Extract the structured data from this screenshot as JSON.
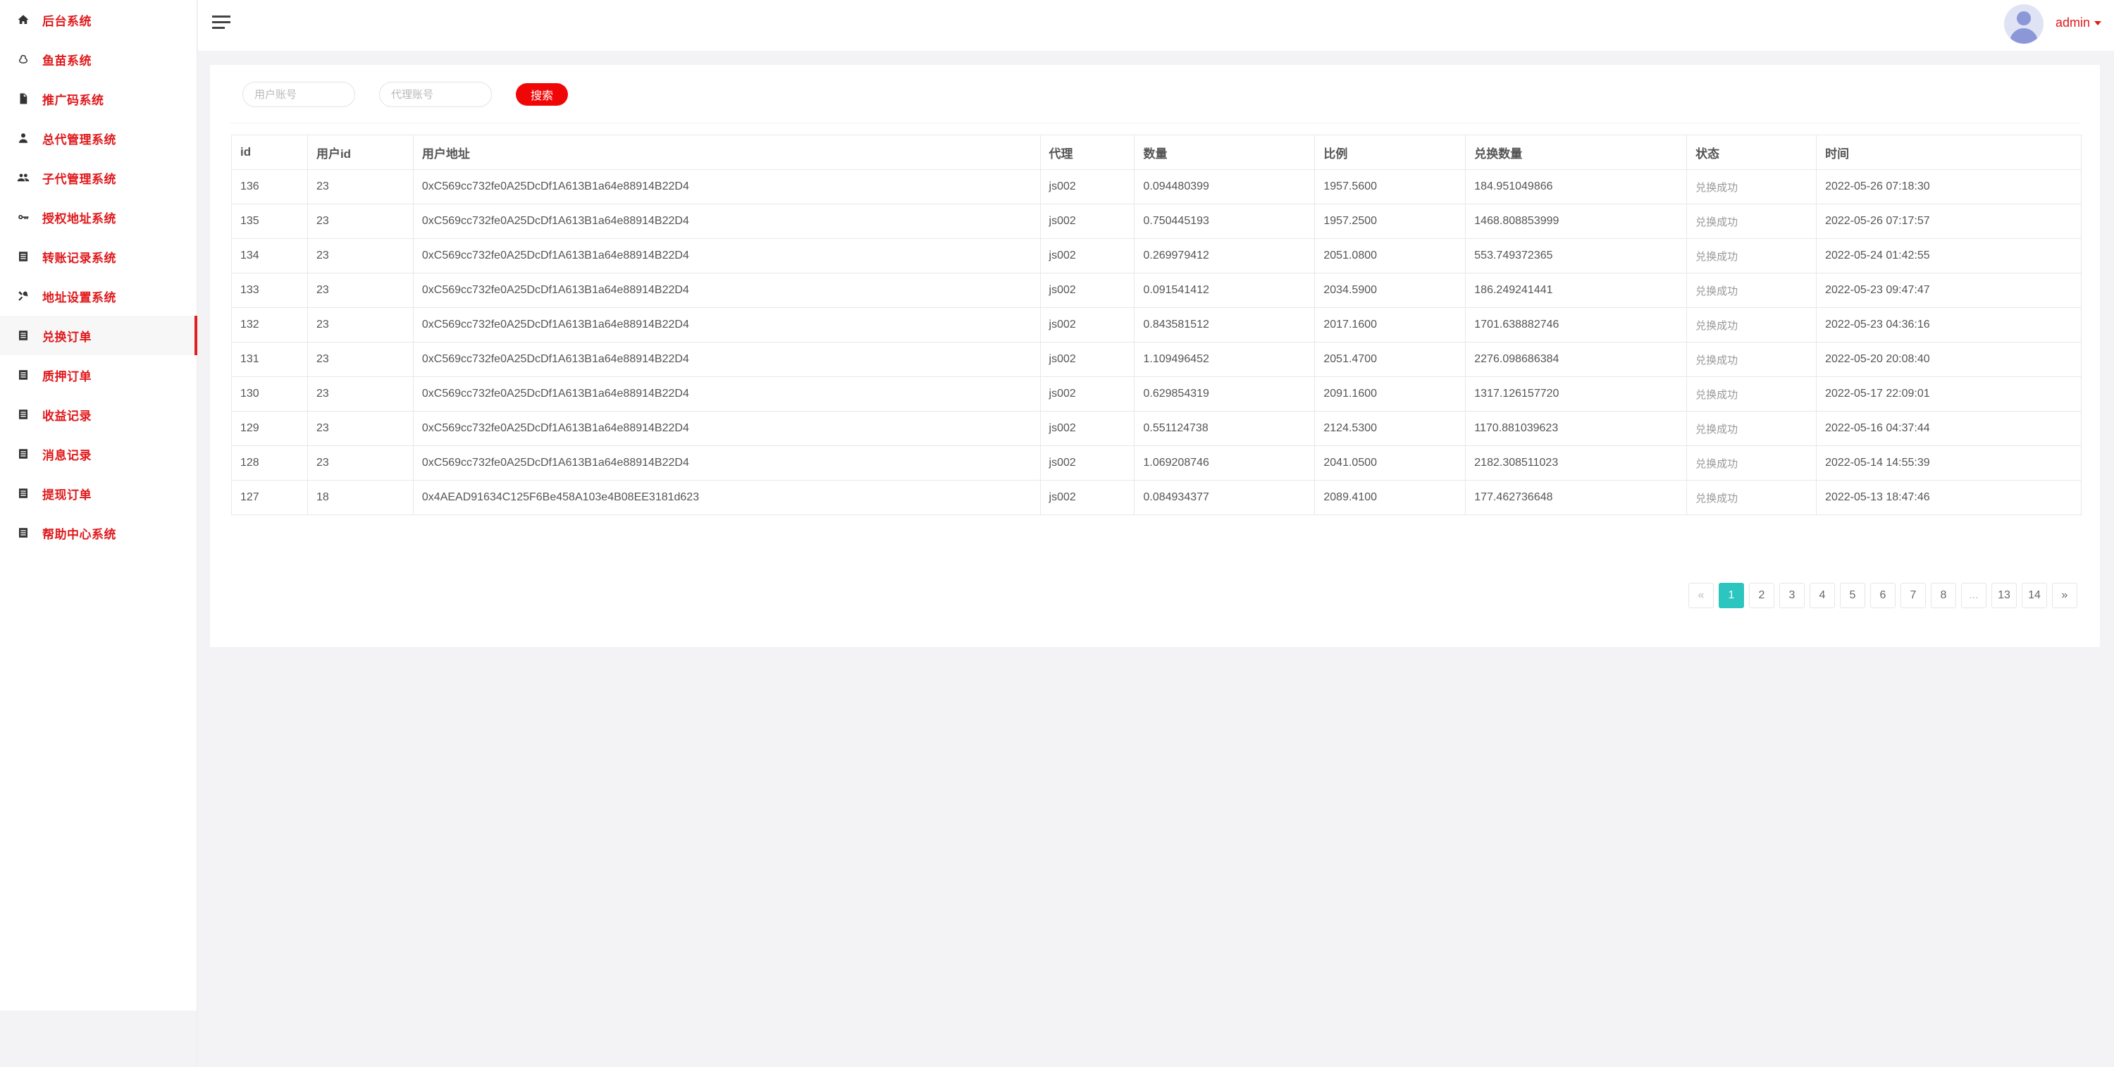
{
  "sidebar": {
    "items": [
      {
        "label": "后台系统",
        "icon": "home-icon"
      },
      {
        "label": "鱼苗系统",
        "icon": "fish-icon"
      },
      {
        "label": "推广码系统",
        "icon": "document-icon"
      },
      {
        "label": "总代管理系统",
        "icon": "person-icon"
      },
      {
        "label": "子代管理系统",
        "icon": "people-icon"
      },
      {
        "label": "授权地址系统",
        "icon": "key-icon"
      },
      {
        "label": "转账记录系统",
        "icon": "list-icon"
      },
      {
        "label": "地址设置系统",
        "icon": "tools-icon"
      },
      {
        "label": "兑换订单",
        "icon": "list-icon",
        "active": true
      },
      {
        "label": "质押订单",
        "icon": "list-icon"
      },
      {
        "label": "收益记录",
        "icon": "list-icon"
      },
      {
        "label": "消息记录",
        "icon": "list-icon"
      },
      {
        "label": "提现订单",
        "icon": "list-icon"
      },
      {
        "label": "帮助中心系统",
        "icon": "list-icon"
      }
    ]
  },
  "header": {
    "user_name": "admin"
  },
  "search": {
    "user_account_placeholder": "用户账号",
    "agent_account_placeholder": "代理账号",
    "search_label": "搜索"
  },
  "table": {
    "headers": [
      "id",
      "用户id",
      "用户地址",
      "代理",
      "数量",
      "比例",
      "兑换数量",
      "状态",
      "时间"
    ],
    "rows": [
      [
        "136",
        "23",
        "0xC569cc732fe0A25DcDf1A613B1a64e88914B22D4",
        "js002",
        "0.094480399",
        "1957.5600",
        "184.951049866",
        "兑换成功",
        "2022-05-26 07:18:30"
      ],
      [
        "135",
        "23",
        "0xC569cc732fe0A25DcDf1A613B1a64e88914B22D4",
        "js002",
        "0.750445193",
        "1957.2500",
        "1468.808853999",
        "兑换成功",
        "2022-05-26 07:17:57"
      ],
      [
        "134",
        "23",
        "0xC569cc732fe0A25DcDf1A613B1a64e88914B22D4",
        "js002",
        "0.269979412",
        "2051.0800",
        "553.749372365",
        "兑换成功",
        "2022-05-24 01:42:55"
      ],
      [
        "133",
        "23",
        "0xC569cc732fe0A25DcDf1A613B1a64e88914B22D4",
        "js002",
        "0.091541412",
        "2034.5900",
        "186.249241441",
        "兑换成功",
        "2022-05-23 09:47:47"
      ],
      [
        "132",
        "23",
        "0xC569cc732fe0A25DcDf1A613B1a64e88914B22D4",
        "js002",
        "0.843581512",
        "2017.1600",
        "1701.638882746",
        "兑换成功",
        "2022-05-23 04:36:16"
      ],
      [
        "131",
        "23",
        "0xC569cc732fe0A25DcDf1A613B1a64e88914B22D4",
        "js002",
        "1.109496452",
        "2051.4700",
        "2276.098686384",
        "兑换成功",
        "2022-05-20 20:08:40"
      ],
      [
        "130",
        "23",
        "0xC569cc732fe0A25DcDf1A613B1a64e88914B22D4",
        "js002",
        "0.629854319",
        "2091.1600",
        "1317.126157720",
        "兑换成功",
        "2022-05-17 22:09:01"
      ],
      [
        "129",
        "23",
        "0xC569cc732fe0A25DcDf1A613B1a64e88914B22D4",
        "js002",
        "0.551124738",
        "2124.5300",
        "1170.881039623",
        "兑换成功",
        "2022-05-16 04:37:44"
      ],
      [
        "128",
        "23",
        "0xC569cc732fe0A25DcDf1A613B1a64e88914B22D4",
        "js002",
        "1.069208746",
        "2041.0500",
        "2182.308511023",
        "兑换成功",
        "2022-05-14 14:55:39"
      ],
      [
        "127",
        "18",
        "0x4AEAD91634C125F6Be458A103e4B08EE3181d623",
        "js002",
        "0.084934377",
        "2089.4100",
        "177.462736648",
        "兑换成功",
        "2022-05-13 18:47:46"
      ]
    ]
  },
  "pagination": {
    "prev": "«",
    "pages": [
      "1",
      "2",
      "3",
      "4",
      "5",
      "6",
      "7",
      "8",
      "...",
      "13",
      "14"
    ],
    "current": "1",
    "next": "»"
  },
  "colors": {
    "accent": "#e0181b",
    "search_button": "#f00606",
    "page_active": "#2cc5c0"
  }
}
